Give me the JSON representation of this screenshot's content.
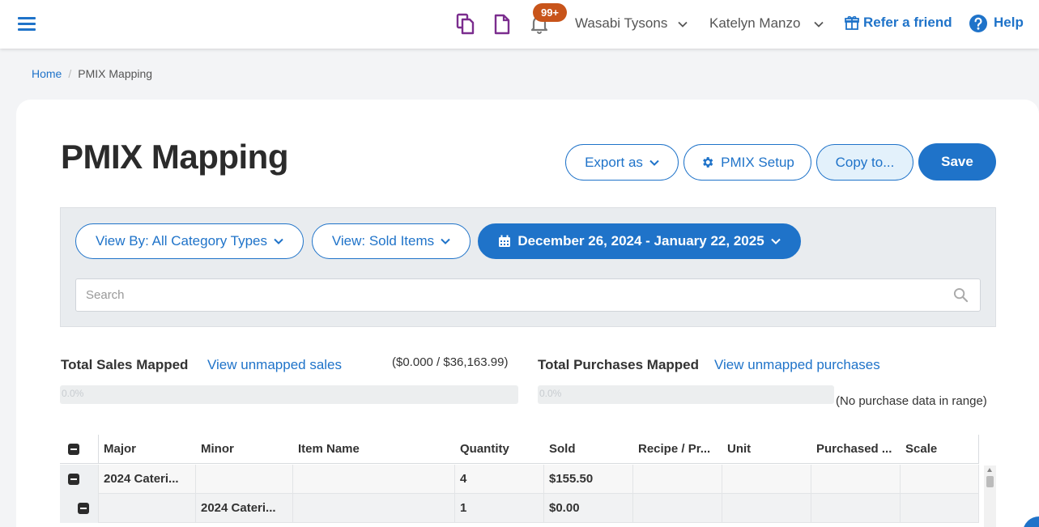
{
  "header": {
    "notification_count": "99+",
    "location": "Wasabi Tysons",
    "user": "Katelyn Manzo",
    "refer_label": "Refer a friend",
    "help_label": "Help"
  },
  "breadcrumb": {
    "home": "Home",
    "separator": "/",
    "current": "PMIX Mapping"
  },
  "page": {
    "title": "PMIX Mapping"
  },
  "actions": {
    "export_label": "Export as",
    "setup_label": "PMIX Setup",
    "copy_label": "Copy to...",
    "save_label": "Save"
  },
  "filters": {
    "view_by": "View By: All Category Types",
    "view": "View: Sold Items",
    "date_range": "December 26, 2024 - January 22, 2025",
    "search_placeholder": "Search"
  },
  "summary": {
    "sales_label": "Total Sales Mapped",
    "sales_link": "View unmapped sales",
    "sales_ratio": "($0.000 / $36,163.99)",
    "sales_progress_text": "0.0%",
    "sales_progress": 0.0,
    "purchases_label": "Total Purchases Mapped",
    "purchases_link": "View unmapped purchases",
    "purchases_note": "(No purchase data in range)",
    "purchases_progress_text": "0.0%",
    "purchases_progress": 0.0
  },
  "table": {
    "columns": [
      "Major",
      "Minor",
      "Item Name",
      "Quantity",
      "Sold",
      "Recipe / Pr...",
      "Unit",
      "Purchased ...",
      "Scale"
    ],
    "rows": [
      [
        "2024 Cateri...",
        "",
        "",
        "4",
        "$155.50",
        "",
        "",
        "",
        ""
      ],
      [
        "",
        "2024 Cateri...",
        "",
        "1",
        "$0.00",
        "",
        "",
        "",
        ""
      ]
    ]
  },
  "colors": {
    "accent": "#1f73c9",
    "badge": "#c8541a",
    "doc_icons": "#7b2d8e"
  }
}
